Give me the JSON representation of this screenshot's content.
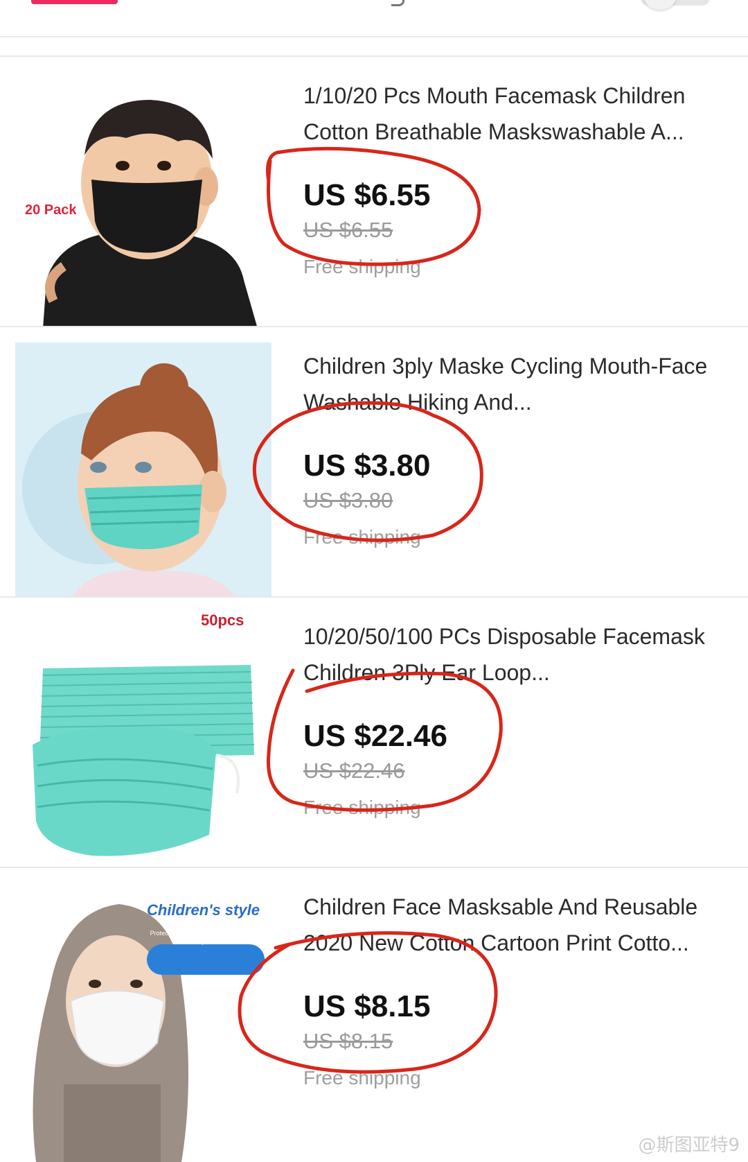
{
  "products": [
    {
      "title": "1/10/20 Pcs Mouth Facemask Children Cotton Breathable Maskswashable A...",
      "price": "US $6.55",
      "original_price": "US $6.55",
      "shipping": "Free shipping",
      "badge": "20 Pack",
      "thumb": "child-black-mask"
    },
    {
      "title": "Children 3ply Maske Cycling Mouth-Face Washable Hiking And...",
      "price": "US $3.80",
      "original_price": "US $3.80",
      "shipping": "Free shipping",
      "badge": "",
      "thumb": "girl-teal-mask"
    },
    {
      "title": "10/20/50/100 PCs Disposable Facemask Children 3Ply Ear Loop...",
      "price": "US $22.46",
      "original_price": "US $22.46",
      "shipping": "Free shipping",
      "badge": "50pcs",
      "thumb": "teal-mask-stack"
    },
    {
      "title": "Children Face Masksable And Reusable 2020 New Cotton Cartoon Print Cotto...",
      "price": "US $8.15",
      "original_price": "US $8.15",
      "shipping": "Free shipping",
      "badge": "Children's style",
      "badge_sub": "Protect children's respiratory health in all aspects",
      "thumb": "baby-white-mask"
    }
  ],
  "watermark": "@斯图亚特9",
  "colors": {
    "annotation": "#d8261a",
    "divider": "#e8e8e8",
    "accent": "#ee2a5f",
    "mask_teal": "#5fd3c4"
  }
}
